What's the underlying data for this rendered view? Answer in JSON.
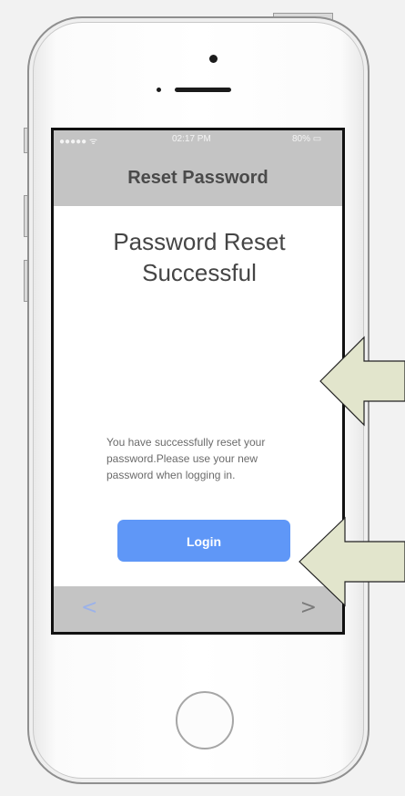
{
  "status_bar": {
    "signal": "●●●●● ᯤ",
    "time": "02:17 PM",
    "battery": "80% ▭"
  },
  "nav": {
    "title": "Reset Password"
  },
  "content": {
    "heading_line1": "Password Reset",
    "heading_line2": "Successful",
    "message_line1": "You have successfully reset your",
    "message_line2": "password.Please use your new",
    "message_line3": "password when logging in."
  },
  "login_button": {
    "label": "Login"
  },
  "toolbar": {
    "back_icon": "<",
    "forward_icon": ">"
  },
  "colors": {
    "bar_gray": "#c4c4c4",
    "button_blue": "#5f97f7",
    "arrow_fill": "#e2e5cc"
  },
  "icons": [
    "camera-icon",
    "speaker-icon",
    "home-button-icon",
    "chevron-left-icon",
    "chevron-right-icon",
    "annotation-arrow-icon"
  ]
}
